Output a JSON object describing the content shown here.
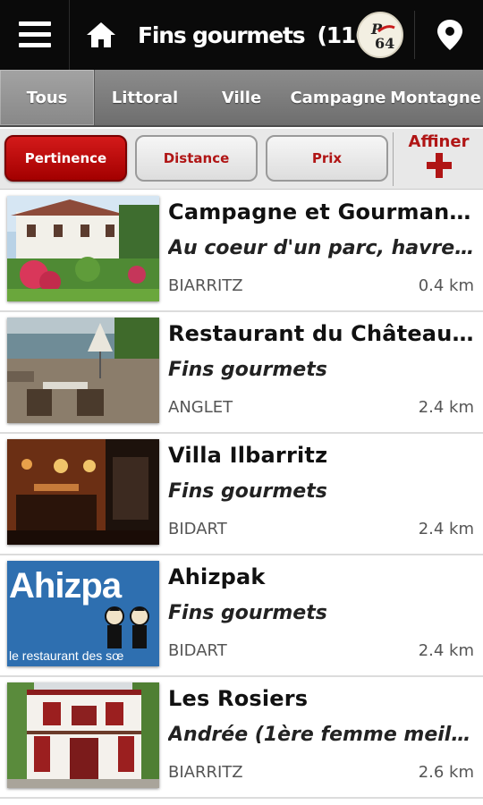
{
  "header": {
    "title": "Fins gourmets",
    "count": "(116)",
    "logo_text": "P 64",
    "icons": [
      "menu-icon",
      "home-icon",
      "location-pin-icon"
    ]
  },
  "tabs": [
    {
      "label": "Tous",
      "active": true
    },
    {
      "label": "Littoral",
      "active": false
    },
    {
      "label": "Ville",
      "active": false
    },
    {
      "label": "Campagne",
      "active": false
    },
    {
      "label": "Montagne",
      "active": false
    }
  ],
  "sort": {
    "pertinence": "Pertinence",
    "distance": "Distance",
    "prix": "Prix",
    "active": "Pertinence",
    "affiner": "Affiner",
    "affiner_icon": "plus-icon"
  },
  "results": [
    {
      "name": "Campagne et Gourmand...",
      "desc": "Au coeur d'un parc, havre de...",
      "city": "BIARRITZ",
      "distance": "0.4 km"
    },
    {
      "name": "Restaurant du Château ...",
      "desc": "Fins gourmets",
      "city": "ANGLET",
      "distance": "2.4 km"
    },
    {
      "name": "Villa Ilbarritz",
      "desc": "Fins gourmets",
      "city": "BIDART",
      "distance": "2.4 km"
    },
    {
      "name": "Ahizpak",
      "desc": "Fins gourmets",
      "city": "BIDART",
      "distance": "2.4 km",
      "thumb_text": "Ahizpa",
      "thumb_subtext": "le restaurant des sœ"
    },
    {
      "name": "Les Rosiers",
      "desc": "Andrée (1ère femme meilleu...",
      "city": "BIARRITZ",
      "distance": "2.6 km"
    }
  ],
  "colors": {
    "topbar": "#0a0a0a",
    "accent_red": "#b01515",
    "tab_bar": "#7d7d7d"
  }
}
